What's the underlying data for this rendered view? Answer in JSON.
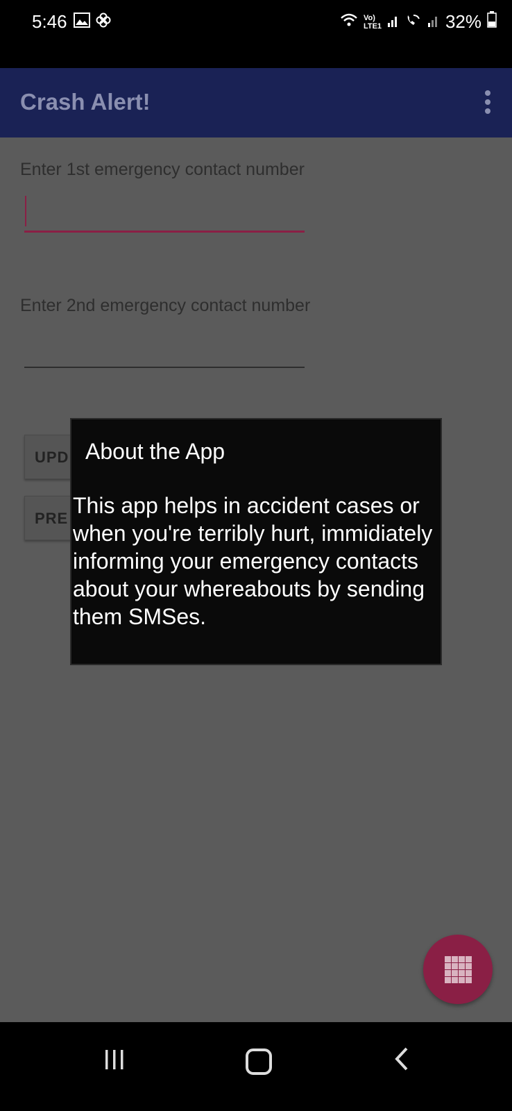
{
  "status_bar": {
    "time": "5:46",
    "battery": "32%",
    "network_label": "Vo) LTE1",
    "icons": [
      "gallery-icon",
      "pinwheel-icon",
      "wifi-icon",
      "signal-icon",
      "wifi-calling-icon",
      "signal-2-icon",
      "battery-icon"
    ]
  },
  "app_bar": {
    "title": "Crash Alert!",
    "overflow_icon": "overflow-menu-icon"
  },
  "form": {
    "contact1_label": "Enter 1st emergency contact number",
    "contact1_value": "",
    "contact2_label": "Enter 2nd emergency contact number",
    "contact2_value": "",
    "update_button_label": "UPD",
    "activate_button_label": "PRE"
  },
  "dialog": {
    "title": "About the App",
    "message": "This app helps in accident cases or when you're terribly hurt, immidiately informing your emergency contacts about your whereabouts by sending them SMSes."
  },
  "fab": {
    "icon": "grid-icon"
  },
  "colors": {
    "app_bar": "#1a2255",
    "accent": "#8a1f45",
    "scrim_background": "#5b5b5b",
    "dialog_background": "#0a0a0a"
  }
}
